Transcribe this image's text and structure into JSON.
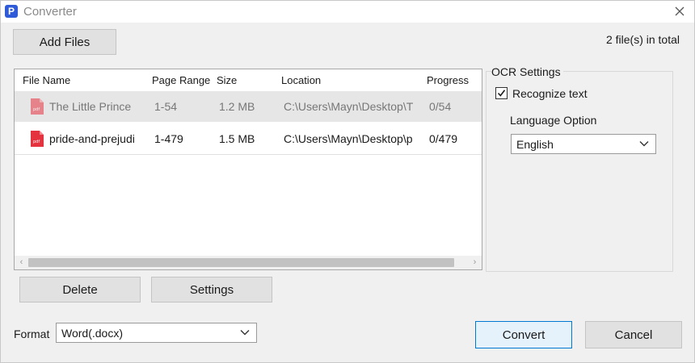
{
  "window": {
    "title": "Converter",
    "app_icon_letter": "P"
  },
  "toolbar": {
    "add_files_label": "Add Files",
    "file_count": "2 file(s) in total"
  },
  "table": {
    "columns": [
      "File Name",
      "Page Range",
      "Size",
      "Location",
      "Progress"
    ],
    "rows": [
      {
        "file_name": "The Little Prince",
        "page_range": "1-54",
        "size": "1.2 MB",
        "location": "C:\\Users\\Mayn\\Desktop\\T",
        "progress": "0/54",
        "selected": true
      },
      {
        "file_name": "pride-and-prejudi",
        "page_range": "1-479",
        "size": "1.5 MB",
        "location": "C:\\Users\\Mayn\\Desktop\\p",
        "progress": "0/479",
        "selected": false
      }
    ]
  },
  "actions": {
    "delete_label": "Delete",
    "settings_label": "Settings"
  },
  "ocr": {
    "group_title": "OCR Settings",
    "recognize_label": "Recognize text",
    "recognize_checked": true,
    "language_label": "Language Option",
    "language_value": "English"
  },
  "format": {
    "label": "Format",
    "value": "Word(.docx)"
  },
  "footer": {
    "convert_label": "Convert",
    "cancel_label": "Cancel"
  },
  "colors": {
    "accent": "#0078d4",
    "pdf_red": "#e5323f",
    "selected_row": "#e6e6e6"
  }
}
